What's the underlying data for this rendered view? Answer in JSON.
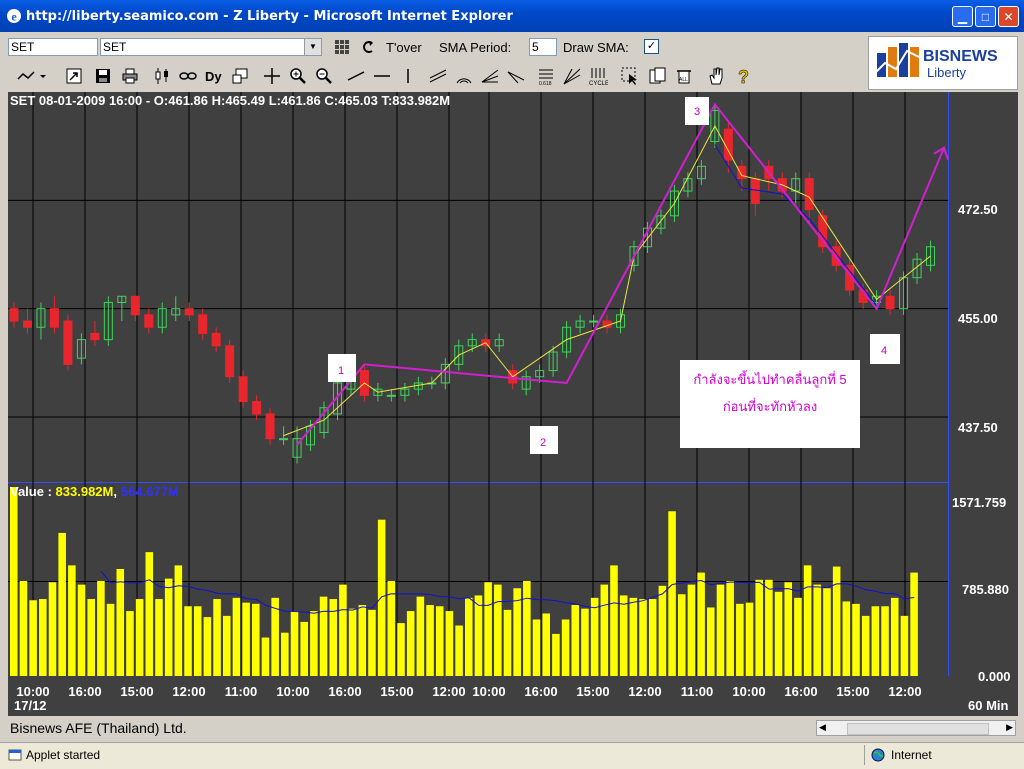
{
  "window": {
    "title": "http://liberty.seamico.com - Z Liberty - Microsoft Internet Explorer"
  },
  "toolbar": {
    "symbol_value": "SET",
    "symbol_select": "SET",
    "tover_label": "T'over",
    "sma_period_label": "SMA Period:",
    "sma_period_value": "5",
    "draw_sma_label": "Draw SMA:",
    "draw_sma_check": "✓"
  },
  "logo": {
    "brand": "BISNEWS",
    "sub": "Liberty"
  },
  "chart_header": "SET 08-01-2009 16:00 - O:461.86 H:465.49 L:461.86 C:465.03 T:833.982M",
  "volume_header": {
    "prefix": "Value : ",
    "v1": "833.982M",
    "sep": ",",
    "v2": "564.677M"
  },
  "colors": {
    "up": "#3fd25a",
    "down": "#e8262d",
    "volume": "#ffff00",
    "avg": "#1010d0",
    "wave": "#d020d0",
    "zigzag": "#e8e840"
  },
  "price_ticks": [
    "472.50",
    "455.00",
    "437.50"
  ],
  "volume_ticks": [
    "1571.759",
    "785.880",
    "0.000"
  ],
  "time_ticks": [
    "10:00",
    "16:00",
    "15:00",
    "12:00",
    "11:00",
    "10:00",
    "16:00",
    "15:00",
    "12:00",
    "10:00",
    "16:00",
    "15:00",
    "12:00",
    "11:00",
    "10:00",
    "16:00",
    "15:00",
    "12:00"
  ],
  "date_label": "17/12",
  "interval_label": "60 Min",
  "wave_labels": [
    "1",
    "2",
    "3",
    "4"
  ],
  "annotation": {
    "line1": "กำลังจะขึ้นไปทำคลื่นลูกที่ 5",
    "line2": "ก่อนที่จะทักหัวลง"
  },
  "footer": {
    "company": "Bisnews AFE (Thailand) Ltd."
  },
  "statusbar": {
    "status": "Applet started",
    "zone": "Internet"
  },
  "chart_data": {
    "type": "candlestick",
    "price_ylim": [
      427,
      490
    ],
    "volume_ylim": [
      0,
      1571.759
    ],
    "candles": [
      [
        455,
        453,
        456,
        452
      ],
      [
        453,
        452,
        455,
        451
      ],
      [
        452,
        455,
        456,
        450
      ],
      [
        455,
        452,
        457,
        451
      ],
      [
        453,
        446,
        454,
        445
      ],
      [
        447,
        450,
        451,
        446
      ],
      [
        451,
        450,
        453,
        449
      ],
      [
        450,
        456,
        457,
        449
      ],
      [
        456,
        457,
        457,
        453
      ],
      [
        457,
        454,
        457,
        453
      ],
      [
        454,
        452,
        455,
        451
      ],
      [
        452,
        455,
        456,
        451
      ],
      [
        454,
        455,
        457,
        453
      ],
      [
        455,
        454,
        456,
        453
      ],
      [
        454,
        451,
        455,
        450
      ],
      [
        451,
        449,
        452,
        448
      ],
      [
        449,
        444,
        450,
        443
      ],
      [
        444,
        440,
        445,
        439
      ],
      [
        440,
        438,
        441,
        437
      ],
      [
        438,
        434,
        439,
        433
      ],
      [
        434,
        434,
        436,
        433
      ],
      [
        431,
        434,
        436,
        430
      ],
      [
        433,
        436,
        437,
        432
      ],
      [
        435,
        439,
        440,
        434
      ],
      [
        438,
        443,
        444,
        437
      ],
      [
        442,
        445,
        446,
        441
      ],
      [
        445,
        441,
        446,
        440
      ],
      [
        441,
        442,
        443,
        440
      ],
      [
        441,
        441,
        442,
        440
      ],
      [
        441,
        442,
        443,
        440
      ],
      [
        442,
        443,
        444,
        441
      ],
      [
        443,
        443,
        444,
        442
      ],
      [
        443,
        446,
        447,
        442
      ],
      [
        446,
        449,
        450,
        445
      ],
      [
        449,
        450,
        451,
        448
      ],
      [
        450,
        449,
        451,
        448
      ],
      [
        449,
        450,
        451,
        448
      ],
      [
        445,
        443,
        446,
        442
      ],
      [
        442,
        444,
        445,
        441
      ],
      [
        444,
        445,
        446,
        443
      ],
      [
        445,
        448,
        449,
        444
      ],
      [
        448,
        452,
        453,
        447
      ],
      [
        452,
        453,
        454,
        451
      ],
      [
        453,
        453,
        454,
        452
      ],
      [
        453,
        452,
        454,
        451
      ],
      [
        452,
        454,
        455,
        451
      ],
      [
        462,
        465,
        466,
        461
      ],
      [
        465,
        468,
        469,
        464
      ],
      [
        468,
        470,
        471,
        467
      ],
      [
        470,
        474,
        475,
        469
      ],
      [
        474,
        476,
        477,
        473
      ],
      [
        476,
        478,
        479,
        475
      ],
      [
        482,
        487,
        488,
        481
      ],
      [
        484,
        479,
        485,
        477
      ],
      [
        478,
        476,
        479,
        474
      ],
      [
        476,
        472,
        477,
        470
      ],
      [
        478,
        476,
        479,
        474
      ],
      [
        476,
        474,
        477,
        473
      ],
      [
        474,
        476,
        477,
        472
      ],
      [
        476,
        471,
        477,
        469
      ],
      [
        470,
        465,
        471,
        464
      ],
      [
        465,
        462,
        466,
        461
      ],
      [
        462,
        458,
        463,
        457
      ],
      [
        458,
        456,
        459,
        455
      ],
      [
        456,
        457,
        458,
        455
      ],
      [
        457,
        455,
        458,
        454
      ],
      [
        455,
        460,
        461,
        454
      ],
      [
        460,
        463,
        464,
        459
      ],
      [
        462,
        465,
        466,
        461
      ]
    ],
    "volumes": [
      1571,
      790,
      630,
      640,
      780,
      1190,
      920,
      760,
      640,
      790,
      600,
      890,
      540,
      640,
      1030,
      640,
      810,
      920,
      580,
      580,
      490,
      640,
      500,
      650,
      610,
      600,
      320,
      650,
      360,
      540,
      450,
      540,
      660,
      640,
      760,
      560,
      590,
      550,
      1300,
      790,
      440,
      540,
      660,
      590,
      580,
      540,
      420,
      650,
      670,
      780,
      760,
      550,
      730,
      790,
      470,
      520,
      350,
      470,
      590,
      560,
      650,
      760,
      920,
      670,
      650,
      640,
      640,
      750,
      1370,
      680,
      760,
      860,
      570,
      760,
      790,
      600,
      610,
      800,
      800,
      700,
      780,
      650,
      920,
      760,
      730,
      910,
      620,
      600,
      500,
      580,
      580,
      650,
      500,
      860
    ]
  }
}
